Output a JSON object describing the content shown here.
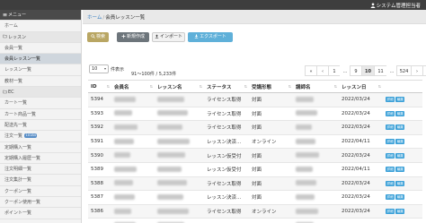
{
  "header": {
    "user_icon": "person-icon",
    "user_label": "システム管理担当者"
  },
  "sidebar": {
    "menu_header": "メニュー",
    "items": [
      {
        "label": "ホーム",
        "type": "item"
      },
      {
        "label": "レッスン",
        "type": "section",
        "icon": "folder-open-icon"
      },
      {
        "label": "会員一覧",
        "type": "item"
      },
      {
        "label": "会員レッスン一覧",
        "type": "active"
      },
      {
        "label": "レッスン一覧",
        "type": "item"
      },
      {
        "label": "教材一覧",
        "type": "item"
      },
      {
        "label": "EC",
        "type": "section",
        "icon": "folder-open-icon"
      },
      {
        "label": "カート一覧",
        "type": "item"
      },
      {
        "label": "カート商品一覧",
        "type": "item"
      },
      {
        "label": "配送先一覧",
        "type": "item"
      },
      {
        "label": "注文一覧",
        "type": "item",
        "badge": "10184"
      },
      {
        "label": "定期購入一覧",
        "type": "item"
      },
      {
        "label": "定期購入履歴一覧",
        "type": "item"
      },
      {
        "label": "注文明細一覧",
        "type": "item"
      },
      {
        "label": "注文集計一覧",
        "type": "item"
      },
      {
        "label": "クーポン一覧",
        "type": "item"
      },
      {
        "label": "クーポン使用一覧",
        "type": "item"
      },
      {
        "label": "ポイント一覧",
        "type": "item"
      }
    ]
  },
  "breadcrumb": {
    "home": "ホーム",
    "separator": "/",
    "current": "会員レッスン一覧"
  },
  "toolbar": {
    "search_label": "検索",
    "new_label": "新規作成",
    "import_label": "インポート",
    "export_label": "エクスポート"
  },
  "list": {
    "per_page_value": "10",
    "per_page_label": "件表示",
    "count_text": "91～100件 / 5,233件"
  },
  "pagination": [
    "«",
    "‹",
    "1",
    "…",
    "9",
    "10",
    "11",
    "…",
    "524",
    "›",
    "»"
  ],
  "pagination_current": "10",
  "table": {
    "columns": [
      "ID",
      "会員名",
      "レッスン名",
      "ステータス",
      "受講形態",
      "講師名",
      "レッスン日",
      ""
    ],
    "rows": [
      {
        "id": "5394",
        "status": "ライセンス取得",
        "format": "対面",
        "date": "2022/03/24"
      },
      {
        "id": "5393",
        "status": "ライセンス取得",
        "format": "対面",
        "date": "2022/03/24"
      },
      {
        "id": "5392",
        "status": "ライセンス取得",
        "format": "対面",
        "date": "2022/03/24"
      },
      {
        "id": "5391",
        "status": "レッスン決済...",
        "format": "オンライン",
        "date": "2022/04/11"
      },
      {
        "id": "5390",
        "status": "レッスン仮受付",
        "format": "対面",
        "date": "2022/03/24"
      },
      {
        "id": "5389",
        "status": "レッスン仮受付",
        "format": "対面",
        "date": "2022/04/11"
      },
      {
        "id": "5388",
        "status": "ライセンス取得",
        "format": "対面",
        "date": "2022/03/24"
      },
      {
        "id": "5387",
        "status": "レッスン決済...",
        "format": "対面",
        "date": "2022/03/24"
      },
      {
        "id": "5386",
        "status": "ライセンス取得",
        "format": "オンライン",
        "date": "2022/03/24"
      },
      {
        "id": "5385",
        "status": "レッスン決済...",
        "format": "オンライン",
        "date": "2022/03/24"
      }
    ],
    "detail_label": "詳細",
    "edit_label": "編集"
  }
}
